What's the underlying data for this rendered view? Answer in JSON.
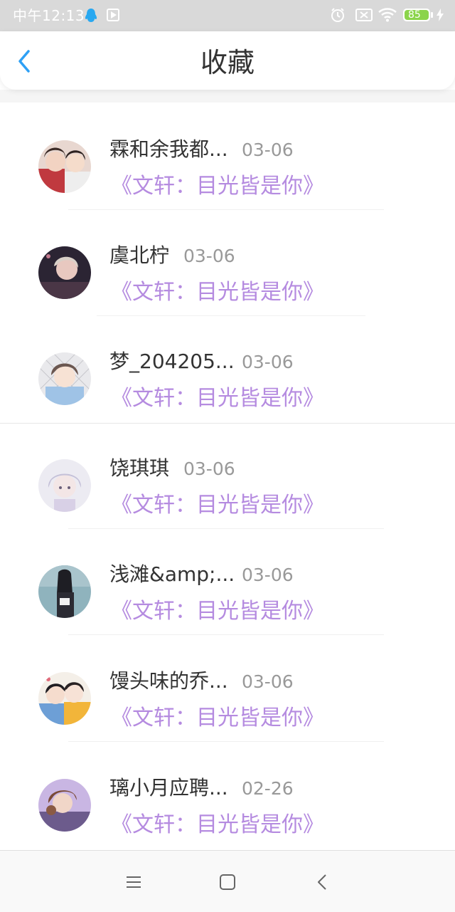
{
  "status_bar": {
    "time": "中午12:13",
    "battery": "85"
  },
  "header": {
    "title": "收藏",
    "back_icon": "chevron-left-icon"
  },
  "favorites": [
    {
      "name": "霖和余我都...",
      "date": "03-06",
      "work": "《文轩：目光皆是你》"
    },
    {
      "name": "虞北柠",
      "date": "03-06",
      "work": "《文轩：目光皆是你》"
    },
    {
      "name": "梦_204205...",
      "date": "03-06",
      "work": "《文轩：目光皆是你》"
    },
    {
      "name": "饶琪琪",
      "date": "03-06",
      "work": "《文轩：目光皆是你》"
    },
    {
      "name": "浅滩&amp;...",
      "date": "03-06",
      "work": "《文轩：目光皆是你》"
    },
    {
      "name": "馒头味的乔...",
      "date": "03-06",
      "work": "《文轩：目光皆是你》"
    },
    {
      "name": "璃小月应聘...",
      "date": "02-26",
      "work": "《文轩：目光皆是你》"
    }
  ],
  "nav_bar": {
    "menu_icon": "menu-icon",
    "home_icon": "square-home-icon",
    "back_icon": "triangle-back-icon"
  },
  "colors": {
    "accent": "#2ea0f5",
    "link": "#b58be0",
    "date": "#999999",
    "battery": "#8bd44b"
  }
}
